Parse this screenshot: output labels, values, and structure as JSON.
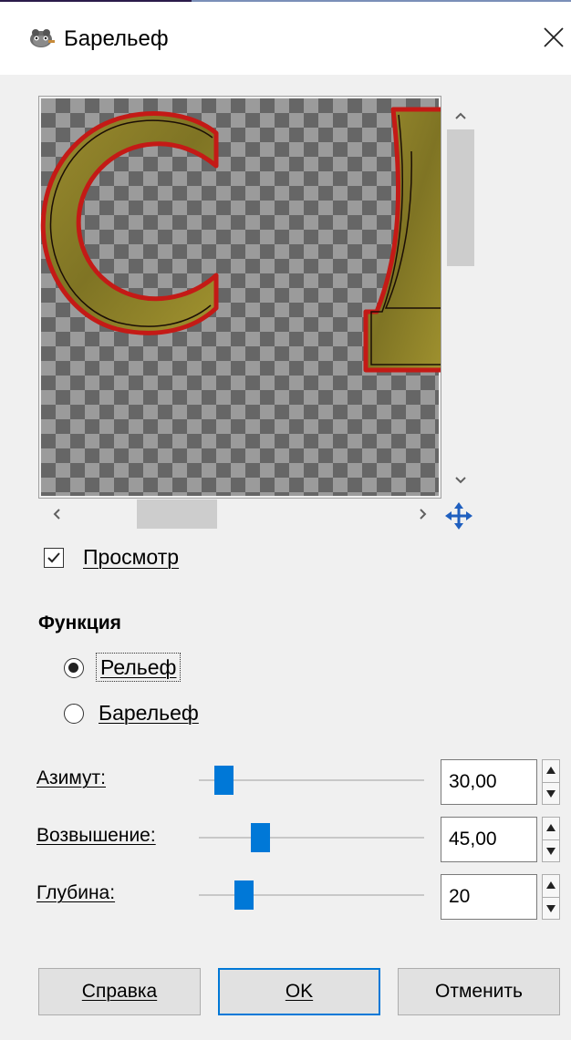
{
  "window": {
    "title": "Барельеф",
    "app_icon": "gimp-icon",
    "close_icon": "close-icon"
  },
  "preview": {
    "checkbox_label": "Просмотр",
    "checkbox_checked": true
  },
  "function_group": {
    "title": "Функция",
    "options": [
      {
        "label": "Рельеф",
        "selected": true
      },
      {
        "label": "Барельеф",
        "selected": false
      }
    ]
  },
  "sliders": [
    {
      "label": "Азимут:",
      "value": "30,00",
      "fraction": 0.11
    },
    {
      "label": "Возвышение:",
      "value": "45,00",
      "fraction": 0.27
    },
    {
      "label": "Глубина:",
      "value": "20",
      "fraction": 0.2
    }
  ],
  "buttons": {
    "help": "Справка",
    "ok": "OK",
    "cancel": "Отменить"
  },
  "colors": {
    "accent": "#0078d7",
    "letter_fill": "#8c7f2a",
    "letter_outline": "#c41a16"
  }
}
